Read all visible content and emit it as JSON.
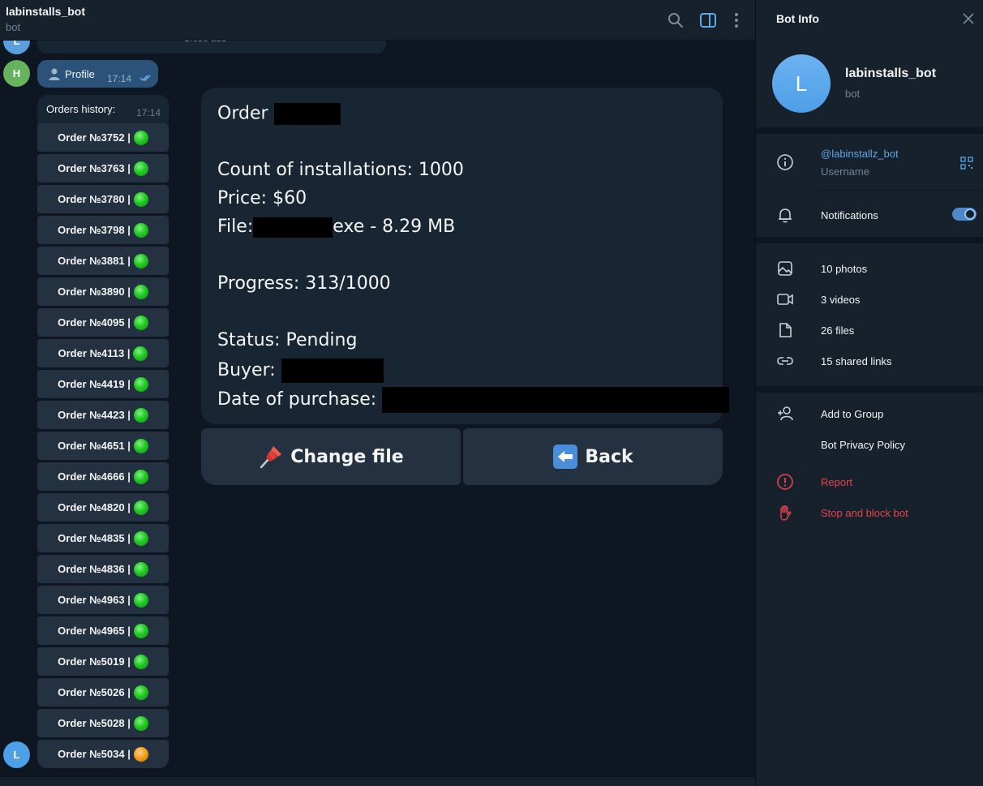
{
  "chat": {
    "title": "labinstalls_bot",
    "subtitle": "bot",
    "prev_message_text": "Close ads",
    "prev_avatar_letter": "L",
    "user_avatar_letter": "H",
    "bot_avatar_letter": "L"
  },
  "profile_message": {
    "label": "Profile",
    "time": "17:14"
  },
  "orders_message": {
    "label": "Orders history:",
    "time": "17:14",
    "orders": [
      {
        "label": "Order №3752 |",
        "status": "green"
      },
      {
        "label": "Order №3763 |",
        "status": "green"
      },
      {
        "label": "Order №3780 |",
        "status": "green"
      },
      {
        "label": "Order №3798 |",
        "status": "green"
      },
      {
        "label": "Order №3881 |",
        "status": "green"
      },
      {
        "label": "Order №3890 |",
        "status": "green"
      },
      {
        "label": "Order №4095 |",
        "status": "green"
      },
      {
        "label": "Order №4113 |",
        "status": "green"
      },
      {
        "label": "Order №4419 |",
        "status": "green"
      },
      {
        "label": "Order №4423 |",
        "status": "green"
      },
      {
        "label": "Order №4651 |",
        "status": "green"
      },
      {
        "label": "Order №4666 |",
        "status": "green"
      },
      {
        "label": "Order №4820 |",
        "status": "green"
      },
      {
        "label": "Order №4835 |",
        "status": "green"
      },
      {
        "label": "Order №4836 |",
        "status": "green"
      },
      {
        "label": "Order №4963 |",
        "status": "green"
      },
      {
        "label": "Order №4965 |",
        "status": "green"
      },
      {
        "label": "Order №5019 |",
        "status": "green"
      },
      {
        "label": "Order №5026 |",
        "status": "green"
      },
      {
        "label": "Order №5028 |",
        "status": "green"
      },
      {
        "label": "Order №5034 |",
        "status": "orange"
      }
    ]
  },
  "order_detail": {
    "order_prefix": "Order",
    "count_line": "Count of installations: 1000",
    "price_line": "Price: $60",
    "file_prefix": "File:",
    "file_suffix": "exe - 8.29 MB",
    "progress_line": "Progress: 313/1000",
    "progress_done": 313,
    "progress_total": 1000,
    "status_line": "Status: Pending",
    "buyer_prefix": "Buyer:",
    "date_prefix": "Date of purchase:"
  },
  "keyboard": {
    "change_file_label": "Change file",
    "back_label": "Back"
  },
  "panel": {
    "title": "Bot Info",
    "avatar_letter": "L",
    "name": "labinstalls_bot",
    "subtitle": "bot",
    "username": "@labinstallz_bot",
    "username_caption": "Username",
    "notifications_label": "Notifications",
    "notifications_on": true,
    "photos": "10 photos",
    "videos": "3 videos",
    "files": "26 files",
    "links": "15 shared links",
    "add_to_group": "Add to Group",
    "privacy_policy": "Bot Privacy Policy",
    "report": "Report",
    "stop_block": "Stop and block bot"
  },
  "colors": {
    "background": "#0e1621",
    "panel": "#17212b",
    "outgoing_bubble": "#2b5278",
    "incoming_bubble": "#182533",
    "accent": "#5fa8e8",
    "danger": "#e5424e",
    "status_green": "#24c924",
    "status_orange": "#f6a21e"
  },
  "icons": [
    "search-icon",
    "sidebar-toggle-icon",
    "more-icon",
    "close-icon",
    "info-icon",
    "qr-code-icon",
    "bell-icon",
    "photo-icon",
    "video-icon",
    "file-icon",
    "link-icon",
    "add-user-icon",
    "report-icon",
    "hand-icon",
    "pushpin-icon",
    "back-arrow-icon",
    "person-icon",
    "double-check-icon"
  ]
}
